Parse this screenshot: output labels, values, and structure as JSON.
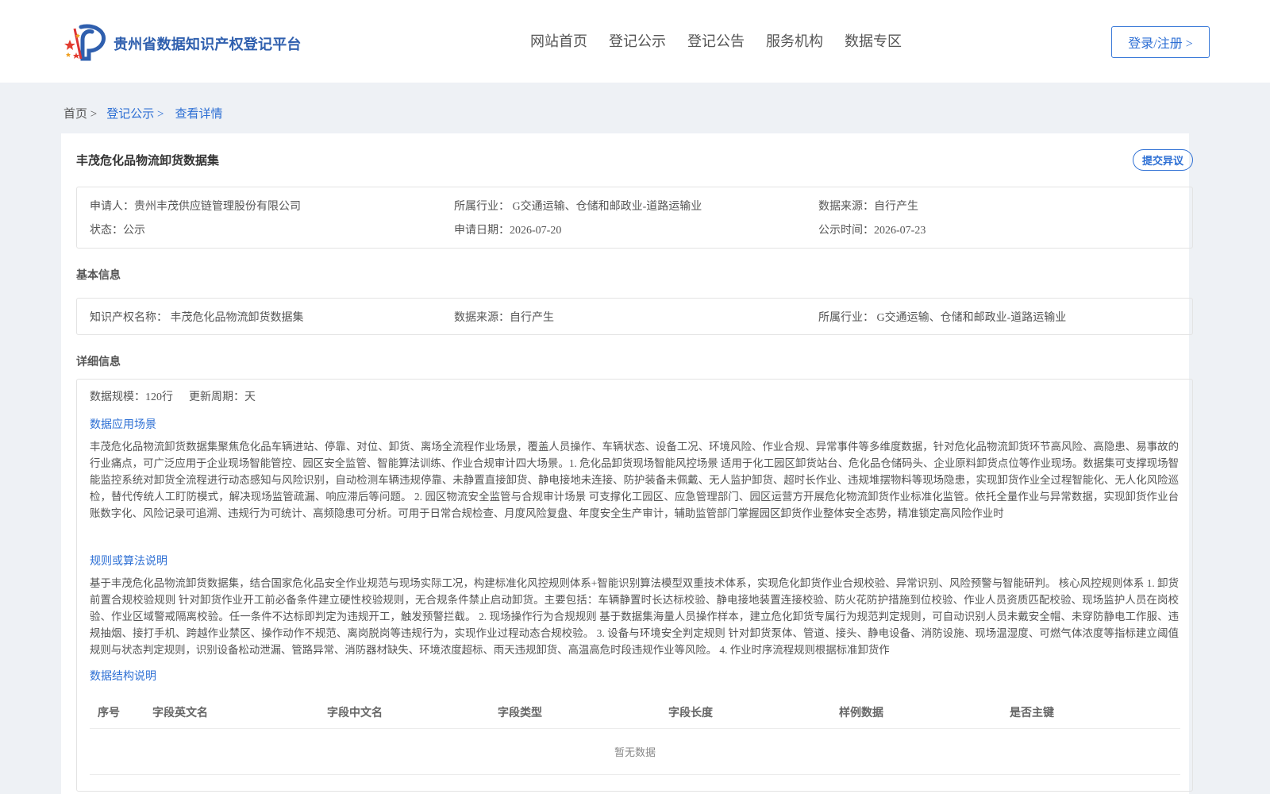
{
  "header": {
    "brand": "贵州省数据知识产权登记平台",
    "nav": [
      "网站首页",
      "登记公示",
      "登记公告",
      "服务机构",
      "数据专区"
    ],
    "login": "登录/注册 >"
  },
  "breadcrumb": {
    "home": "首页 >",
    "list": "登记公示 >",
    "current": "查看详情"
  },
  "record": {
    "title": "丰茂危化品物流卸货数据集",
    "objection_button": "提交异议",
    "summary": {
      "applicant": "申请人：贵州丰茂供应链管理股份有限公司",
      "industry": "所属行业： G交通运输、仓储和邮政业-道路运输业",
      "source": "数据来源：自行产生",
      "status": "状态：公示",
      "apply_date": "申请日期：2026-07-20",
      "publish_date": "公示时间：2026-07-23"
    },
    "basic": {
      "heading": "基本信息",
      "ip_name": "知识产权名称： 丰茂危化品物流卸货数据集",
      "source": "数据来源：自行产生",
      "industry": "所属行业： G交通运输、仓储和邮政业-道路运输业"
    },
    "detail": {
      "heading": "详细信息",
      "scale": "数据规模：120行",
      "cycle": "更新周期：天",
      "scenario_title": "数据应用场景",
      "scenario_text": "丰茂危化品物流卸货数据集聚焦危化品车辆进站、停靠、对位、卸货、离场全流程作业场景，覆盖人员操作、车辆状态、设备工况、环境风险、作业合规、异常事件等多维度数据，针对危化品物流卸货环节高风险、高隐患、易事故的行业痛点，可广泛应用于企业现场智能管控、园区安全监管、智能算法训练、作业合规审计四大场景。1. 危化品卸货现场智能风控场景 适用于化工园区卸货站台、危化品仓储码头、企业原料卸货点位等作业现场。数据集可支撑现场智能监控系统对卸货全流程进行动态感知与风险识别，自动检测车辆违规停靠、未静置直接卸货、静电接地未连接、防护装备未佩戴、无人监护卸货、超时长作业、违规堆摆物料等现场隐患，实现卸货作业全过程智能化、无人化风险巡检，替代传统人工盯防模式，解决现场监管疏漏、响应滞后等问题。 2. 园区物流安全监管与合规审计场景 可支撑化工园区、应急管理部门、园区运营方开展危化物流卸货作业标准化监管。依托全量作业与异常数据，实现卸货作业台账数字化、风险记录可追溯、违规行为可统计、高频隐患可分析。可用于日常合规检查、月度风险复盘、年度安全生产审计，辅助监管部门掌握园区卸货作业整体安全态势，精准锁定高风险作业时",
      "rules_title": "规则或算法说明",
      "rules_text": "基于丰茂危化品物流卸货数据集，结合国家危化品安全作业规范与现场实际工况，构建标准化风控规则体系+智能识别算法模型双重技术体系，实现危化卸货作业合规校验、异常识别、风险预警与智能研判。 核心风控规则体系 1. 卸货前置合规校验规则 针对卸货作业开工前必备条件建立硬性校验规则，无合规条件禁止启动卸货。主要包括：车辆静置时长达标校验、静电接地装置连接校验、防火花防护措施到位校验、作业人员资质匹配校验、现场监护人员在岗校验、作业区域警戒隔离校验。任一条件不达标即判定为违规开工，触发预警拦截。 2. 现场操作行为合规规则 基于数据集海量人员操作样本，建立危化卸货专属行为规范判定规则，可自动识别人员未戴安全帽、未穿防静电工作服、违规抽烟、接打手机、跨越作业禁区、操作动作不规范、离岗脱岗等违规行为，实现作业过程动态合规校验。 3. 设备与环境安全判定规则 针对卸货泵体、管道、接头、静电设备、消防设施、现场温湿度、可燃气体浓度等指标建立阈值规则与状态判定规则，识别设备松动泄漏、管路异常、消防器材缺失、环境浓度超标、雨天违规卸货、高温高危时段违规作业等风险。 4. 作业时序流程规则根据标准卸货作",
      "structure_title": "数据结构说明",
      "table_headers": [
        "序号",
        "字段英文名",
        "字段中文名",
        "字段类型",
        "字段长度",
        "样例数据",
        "是否主键"
      ],
      "table_empty": "暂无数据"
    }
  },
  "colors": {
    "brand": "#2f5fae",
    "link": "#2d6fd4",
    "page_bg": "#eef1f5"
  },
  "icons": [
    "national-emblem-logo"
  ]
}
